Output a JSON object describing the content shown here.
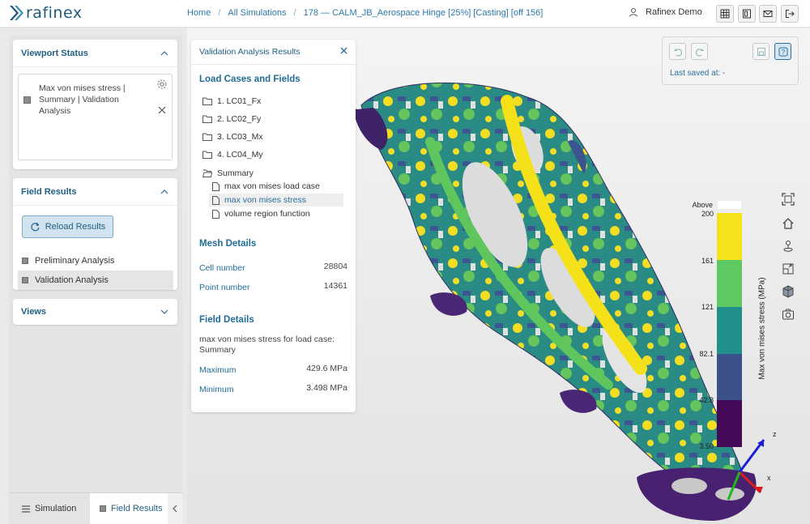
{
  "app": {
    "brand": "rafinex",
    "accent": "#1f5f84"
  },
  "breadcrumbs": [
    "Home",
    "All Simulations",
    "178 — CALM_JB_Aerospace Hinge [25%] [Casting] [off 156]"
  ],
  "user": {
    "name": "Rafinex Demo",
    "icon": "user-icon"
  },
  "toolbar_icons": [
    "table-icon",
    "document-icon",
    "mail-icon",
    "logout-icon"
  ],
  "viewport_status": {
    "title": "Viewport Status",
    "entry_text": "Max von mises stress | Summary | Validation Analysis"
  },
  "field_results": {
    "title": "Field Results",
    "reload_label": "Reload Results",
    "items": [
      {
        "label": "Preliminary Analysis"
      },
      {
        "label": "Validation Analysis"
      }
    ]
  },
  "views": {
    "title": "Views"
  },
  "bottom_tabs": {
    "simulation": "Simulation",
    "field_results": "Field Results"
  },
  "validation_panel": {
    "title": "Validation Analysis Results",
    "load_cases_title": "Load Cases and Fields",
    "folders": [
      "1. LC01_Fx",
      "2. LC02_Fy",
      "3. LC03_Mx",
      "4. LC04_My",
      "Summary"
    ],
    "summary_fields": [
      "max von mises load case",
      "max von mises stress",
      "volume region function"
    ],
    "mesh_details_title": "Mesh Details",
    "cell_number_label": "Cell number",
    "cell_number": "28804",
    "point_number_label": "Point number",
    "point_number": "14361",
    "field_details_title": "Field Details",
    "field_desc": "max von mises stress for load case: Summary",
    "maximum_label": "Maximum",
    "maximum": "429.6 MPa",
    "minimum_label": "Minimum",
    "minimum": "3.498 MPa"
  },
  "viewport": {
    "last_saved": "Last saved at: -",
    "side_tools": [
      "fit-view-icon",
      "home-icon",
      "reset-view-icon",
      "view-cube-icon",
      "perspective-icon",
      "camera-icon"
    ]
  },
  "legend": {
    "title": "Max von mises stress (MPa)",
    "above_label": "Above",
    "ticks": [
      "200",
      "161",
      "121",
      "82.1",
      "42.8",
      "3.50"
    ],
    "colors": [
      "#f6e21c",
      "#5ec862",
      "#21908c",
      "#3c508a",
      "#440a58"
    ]
  },
  "axes": {
    "z": "z",
    "x": "x"
  }
}
